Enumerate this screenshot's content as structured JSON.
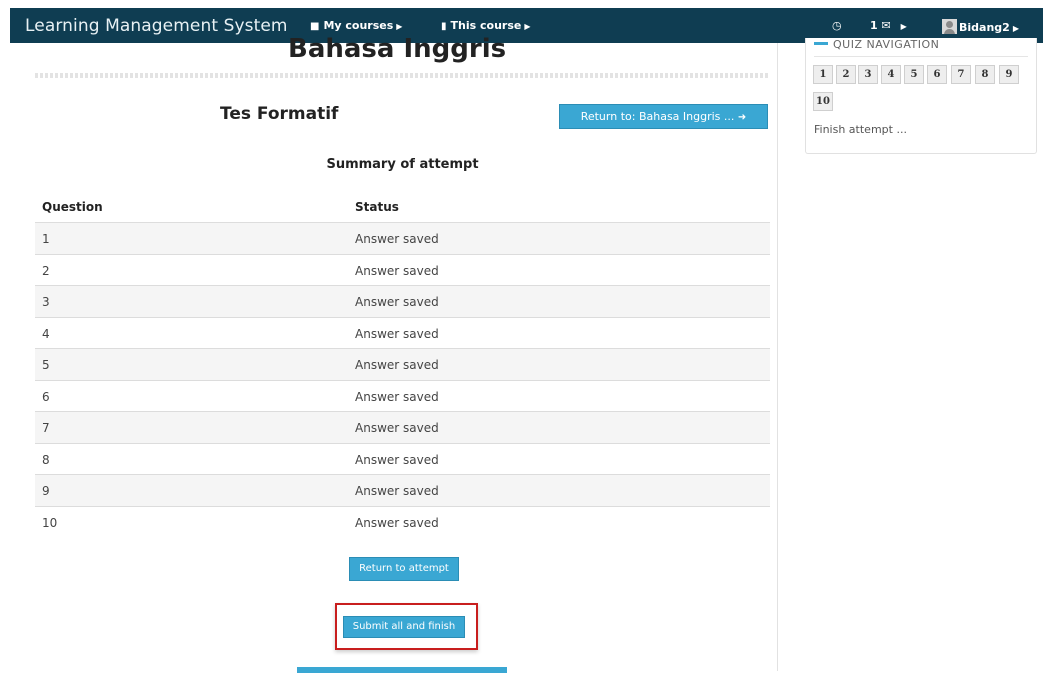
{
  "header": {
    "brand": "Learning Management System",
    "my_courses": "My courses",
    "this_course": "This course",
    "message_count": "1",
    "user_name": "Bidang2"
  },
  "main": {
    "course_title": "Bahasa Inggris",
    "quiz_title": "Tes Formatif",
    "return_course_button": "Return to: Bahasa Inggris ...",
    "summary_title": "Summary of attempt",
    "table": {
      "headers": [
        "Question",
        "Status"
      ],
      "rows": [
        {
          "question": "1",
          "status": "Answer saved"
        },
        {
          "question": "2",
          "status": "Answer saved"
        },
        {
          "question": "3",
          "status": "Answer saved"
        },
        {
          "question": "4",
          "status": "Answer saved"
        },
        {
          "question": "5",
          "status": "Answer saved"
        },
        {
          "question": "6",
          "status": "Answer saved"
        },
        {
          "question": "7",
          "status": "Answer saved"
        },
        {
          "question": "8",
          "status": "Answer saved"
        },
        {
          "question": "9",
          "status": "Answer saved"
        },
        {
          "question": "10",
          "status": "Answer saved"
        }
      ]
    },
    "return_attempt_button": "Return to attempt",
    "submit_button": "Submit all and finish"
  },
  "sidebar": {
    "heading": "QUIZ NAVIGATION",
    "questions": [
      "1",
      "2",
      "3",
      "4",
      "5",
      "6",
      "7",
      "8",
      "9",
      "10"
    ],
    "finish_link": "Finish attempt ..."
  },
  "colors": {
    "navbar": "#0f3d52",
    "accent": "#3aa7d3",
    "highlight": "#c81e1e"
  }
}
